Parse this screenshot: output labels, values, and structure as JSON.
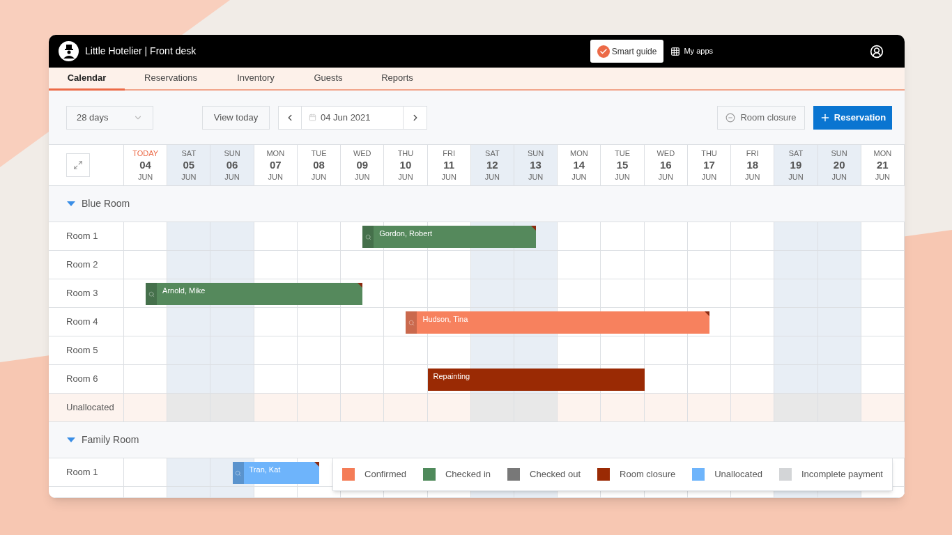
{
  "header": {
    "title": "Little Hotelier | Front desk",
    "smart_guide": "Smart guide",
    "my_apps": "My apps"
  },
  "tabs": [
    {
      "label": "Calendar",
      "selected": true
    },
    {
      "label": "Reservations",
      "selected": false
    },
    {
      "label": "Inventory",
      "selected": false
    },
    {
      "label": "Guests",
      "selected": false
    },
    {
      "label": "Reports",
      "selected": false
    }
  ],
  "toolbar": {
    "range": "28 days",
    "view_today": "View today",
    "date": "04 Jun 2021",
    "room_closure": "Room closure",
    "reservation": "Reservation"
  },
  "days": [
    {
      "weekday": "TODAY",
      "date": "04",
      "month": "JUN",
      "today": true,
      "weekend": false
    },
    {
      "weekday": "SAT",
      "date": "05",
      "month": "JUN",
      "today": false,
      "weekend": true
    },
    {
      "weekday": "SUN",
      "date": "06",
      "month": "JUN",
      "today": false,
      "weekend": true
    },
    {
      "weekday": "MON",
      "date": "07",
      "month": "JUN",
      "today": false,
      "weekend": false
    },
    {
      "weekday": "TUE",
      "date": "08",
      "month": "JUN",
      "today": false,
      "weekend": false
    },
    {
      "weekday": "WED",
      "date": "09",
      "month": "JUN",
      "today": false,
      "weekend": false
    },
    {
      "weekday": "THU",
      "date": "10",
      "month": "JUN",
      "today": false,
      "weekend": false
    },
    {
      "weekday": "FRI",
      "date": "11",
      "month": "JUN",
      "today": false,
      "weekend": false
    },
    {
      "weekday": "SAT",
      "date": "12",
      "month": "JUN",
      "today": false,
      "weekend": true
    },
    {
      "weekday": "SUN",
      "date": "13",
      "month": "JUN",
      "today": false,
      "weekend": true
    },
    {
      "weekday": "MON",
      "date": "14",
      "month": "JUN",
      "today": false,
      "weekend": false
    },
    {
      "weekday": "TUE",
      "date": "15",
      "month": "JUN",
      "today": false,
      "weekend": false
    },
    {
      "weekday": "WED",
      "date": "16",
      "month": "JUN",
      "today": false,
      "weekend": false
    },
    {
      "weekday": "THU",
      "date": "17",
      "month": "JUN",
      "today": false,
      "weekend": false
    },
    {
      "weekday": "FRI",
      "date": "18",
      "month": "JUN",
      "today": false,
      "weekend": false
    },
    {
      "weekday": "SAT",
      "date": "19",
      "month": "JUN",
      "today": false,
      "weekend": true
    },
    {
      "weekday": "SUN",
      "date": "20",
      "month": "JUN",
      "today": false,
      "weekend": true
    },
    {
      "weekday": "MON",
      "date": "21",
      "month": "JUN",
      "today": false,
      "weekend": false
    }
  ],
  "room_types": [
    {
      "name": "Blue Room",
      "expanded": true,
      "rooms": [
        {
          "name": "Room 1",
          "kind": "room",
          "cells": [
            {
              "kind": "free"
            },
            {
              "kind": "free"
            },
            {
              "kind": "free"
            },
            {
              "kind": "free"
            },
            {
              "kind": "free"
            },
            {
              "kind": "arrival",
              "guest": "Gordon, Robert",
              "color": "#55895c",
              "flag": true
            },
            {
              "kind": "stay"
            },
            {
              "kind": "stay"
            },
            {
              "kind": "stay"
            },
            {
              "kind": "departure"
            },
            {
              "kind": "free"
            },
            {
              "kind": "free"
            },
            {
              "kind": "free"
            },
            {
              "kind": "free"
            },
            {
              "kind": "free"
            },
            {
              "kind": "free"
            },
            {
              "kind": "free"
            },
            {
              "kind": "free"
            }
          ]
        },
        {
          "name": "Room 2",
          "kind": "room",
          "cells": [
            {
              "kind": "free"
            },
            {
              "kind": "free"
            },
            {
              "kind": "free"
            },
            {
              "kind": "free"
            },
            {
              "kind": "free"
            },
            {
              "kind": "free"
            },
            {
              "kind": "free"
            },
            {
              "kind": "free"
            },
            {
              "kind": "free"
            },
            {
              "kind": "free"
            },
            {
              "kind": "free"
            },
            {
              "kind": "free"
            },
            {
              "kind": "free"
            },
            {
              "kind": "free"
            },
            {
              "kind": "free"
            },
            {
              "kind": "free"
            },
            {
              "kind": "free"
            },
            {
              "kind": "free"
            }
          ]
        },
        {
          "name": "Room 3",
          "kind": "room",
          "cells": [
            {
              "kind": "arrival",
              "guest": "Arnold, Mike",
              "color": "#55895c",
              "flag": true
            },
            {
              "kind": "stay"
            },
            {
              "kind": "stay"
            },
            {
              "kind": "stay"
            },
            {
              "kind": "stay"
            },
            {
              "kind": "departure"
            },
            {
              "kind": "free"
            },
            {
              "kind": "free"
            },
            {
              "kind": "free"
            },
            {
              "kind": "free"
            },
            {
              "kind": "free"
            },
            {
              "kind": "free"
            },
            {
              "kind": "free"
            },
            {
              "kind": "free"
            },
            {
              "kind": "free"
            },
            {
              "kind": "free"
            },
            {
              "kind": "free"
            },
            {
              "kind": "free"
            }
          ]
        },
        {
          "name": "Room 4",
          "kind": "room",
          "cells": [
            {
              "kind": "free"
            },
            {
              "kind": "free"
            },
            {
              "kind": "free"
            },
            {
              "kind": "free"
            },
            {
              "kind": "free"
            },
            {
              "kind": "free"
            },
            {
              "kind": "arrival",
              "guest": "Hudson, Tina",
              "color": "#f7815e",
              "flag": true
            },
            {
              "kind": "stay"
            },
            {
              "kind": "stay"
            },
            {
              "kind": "stay"
            },
            {
              "kind": "stay"
            },
            {
              "kind": "stay"
            },
            {
              "kind": "stay"
            },
            {
              "kind": "departure"
            },
            {
              "kind": "free"
            },
            {
              "kind": "free"
            },
            {
              "kind": "free"
            },
            {
              "kind": "free"
            }
          ]
        },
        {
          "name": "Room 5",
          "kind": "room",
          "cells": [
            {
              "kind": "free"
            },
            {
              "kind": "free"
            },
            {
              "kind": "free"
            },
            {
              "kind": "free"
            },
            {
              "kind": "free"
            },
            {
              "kind": "free"
            },
            {
              "kind": "free"
            },
            {
              "kind": "free"
            },
            {
              "kind": "free"
            },
            {
              "kind": "free"
            },
            {
              "kind": "free"
            },
            {
              "kind": "free"
            },
            {
              "kind": "free"
            },
            {
              "kind": "free"
            },
            {
              "kind": "free"
            },
            {
              "kind": "free"
            },
            {
              "kind": "free"
            },
            {
              "kind": "free"
            }
          ]
        },
        {
          "name": "Room 6",
          "kind": "room",
          "cells": [
            {
              "kind": "free"
            },
            {
              "kind": "free"
            },
            {
              "kind": "free"
            },
            {
              "kind": "free"
            },
            {
              "kind": "free"
            },
            {
              "kind": "free"
            },
            {
              "kind": "free"
            },
            {
              "kind": "closure",
              "guest": "Repainting",
              "color": "#9a2a04",
              "flag": false
            },
            {
              "kind": "stay"
            },
            {
              "kind": "stay"
            },
            {
              "kind": "stay"
            },
            {
              "kind": "stay"
            },
            {
              "kind": "free"
            },
            {
              "kind": "free"
            },
            {
              "kind": "free"
            },
            {
              "kind": "free"
            },
            {
              "kind": "free"
            },
            {
              "kind": "free"
            }
          ]
        },
        {
          "name": "Unallocated",
          "kind": "unallocated",
          "cells": [
            {
              "kind": "free"
            },
            {
              "kind": "free"
            },
            {
              "kind": "free"
            },
            {
              "kind": "free"
            },
            {
              "kind": "free"
            },
            {
              "kind": "free"
            },
            {
              "kind": "free"
            },
            {
              "kind": "free"
            },
            {
              "kind": "free"
            },
            {
              "kind": "free"
            },
            {
              "kind": "free"
            },
            {
              "kind": "free"
            },
            {
              "kind": "free"
            },
            {
              "kind": "free"
            },
            {
              "kind": "free"
            },
            {
              "kind": "free"
            },
            {
              "kind": "free"
            },
            {
              "kind": "free"
            }
          ]
        }
      ]
    },
    {
      "name": "Family Room",
      "expanded": true,
      "rooms": [
        {
          "name": "Room 1",
          "kind": "room",
          "cells": [
            {
              "kind": "free"
            },
            {
              "kind": "free"
            },
            {
              "kind": "arrival",
              "guest": "Tran, Kat",
              "color": "#6eb4fb",
              "flag": true
            },
            {
              "kind": "stay"
            },
            {
              "kind": "departure"
            },
            {
              "kind": "free"
            },
            {
              "kind": "free"
            },
            {
              "kind": "free"
            },
            {
              "kind": "free"
            },
            {
              "kind": "free"
            },
            {
              "kind": "free"
            },
            {
              "kind": "free"
            },
            {
              "kind": "free"
            },
            {
              "kind": "free"
            },
            {
              "kind": "free"
            },
            {
              "kind": "free"
            },
            {
              "kind": "free"
            },
            {
              "kind": "free"
            }
          ]
        },
        {
          "kind": "cut",
          "cells": [
            {
              "kind": "free"
            },
            {
              "kind": "free"
            },
            {
              "kind": "free"
            },
            {
              "kind": "free"
            },
            {
              "kind": "free"
            },
            {
              "kind": "free"
            },
            {
              "kind": "free"
            },
            {
              "kind": "free"
            },
            {
              "kind": "free"
            },
            {
              "kind": "free"
            },
            {
              "kind": "free"
            },
            {
              "kind": "free"
            },
            {
              "kind": "free"
            },
            {
              "kind": "free"
            },
            {
              "kind": "free"
            },
            {
              "kind": "free"
            },
            {
              "kind": "free"
            },
            {
              "kind": "free"
            }
          ]
        }
      ]
    }
  ],
  "legend": [
    {
      "label": "Confirmed",
      "color": "#f47c57"
    },
    {
      "label": "Checked in",
      "color": "#4f8a5b"
    },
    {
      "label": "Checked out",
      "color": "#787878"
    },
    {
      "label": "Room closure",
      "color": "#9a2a04"
    },
    {
      "label": "Unallocated",
      "color": "#6eb4fb"
    },
    {
      "label": "Incomplete payment",
      "color": "#d3d5d7"
    }
  ]
}
